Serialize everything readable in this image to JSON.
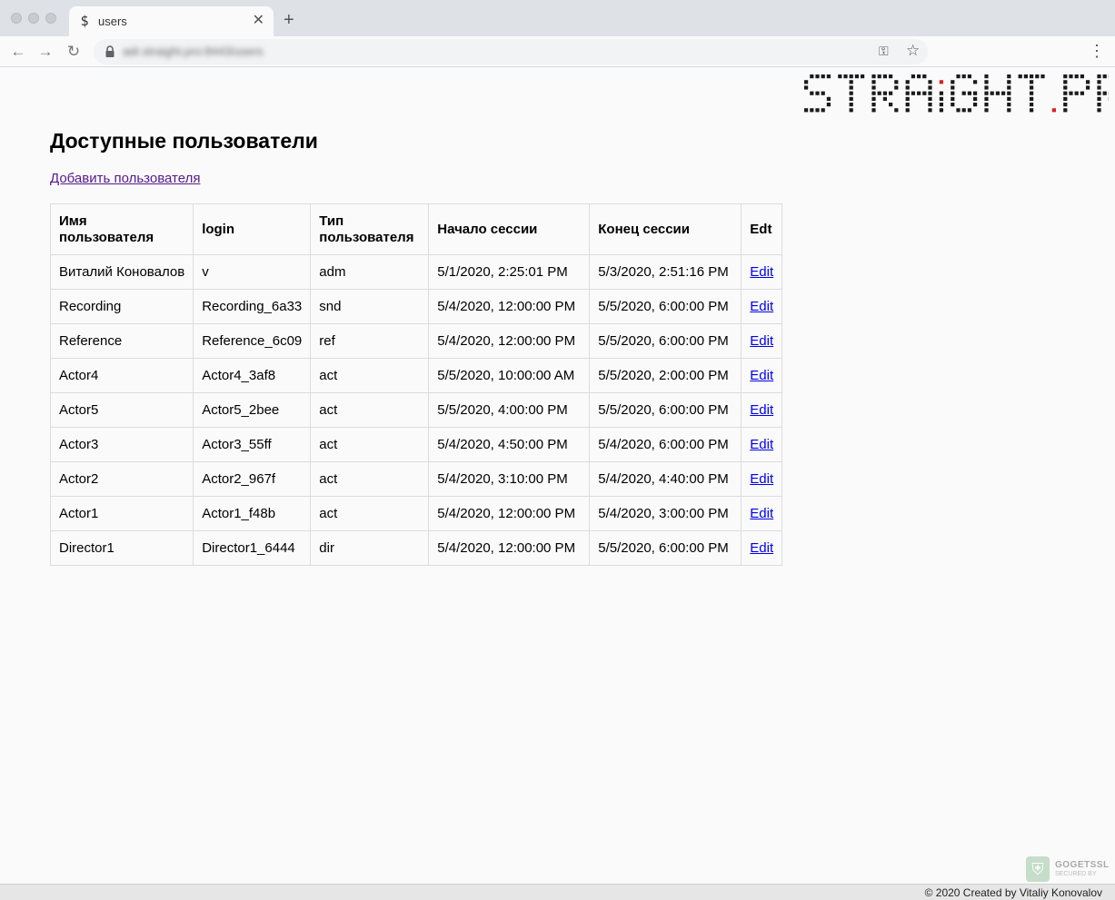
{
  "browser": {
    "tab_title": "users",
    "tab_favicon": "$",
    "url": "adr.straight.pro:8443/users",
    "icons": [
      "close-icon",
      "plus-icon",
      "back-arrow-icon",
      "forward-arrow-icon",
      "reload-icon",
      "lock-icon",
      "key-icon",
      "star-icon",
      "menu-dots-icon"
    ]
  },
  "logo": {
    "text": "STRAIGHT.PRO",
    "accent_color": "#e02020"
  },
  "page": {
    "title": "Доступные пользователи",
    "add_user_label": "Добавить пользователя"
  },
  "table": {
    "headers": {
      "name": [
        "Имя",
        "пользователя"
      ],
      "login": "login",
      "type": [
        "Тип",
        "пользователя"
      ],
      "start": "Начало сессии",
      "end": "Конец сессии",
      "edit": "Edt"
    },
    "rows": [
      {
        "name": "Виталий Коновалов",
        "login": "v",
        "type": "adm",
        "start": "5/1/2020, 2:25:01 PM",
        "end": "5/3/2020, 2:51:16 PM",
        "edit": "Edit"
      },
      {
        "name": "Recording",
        "login": "Recording_6a33",
        "type": "snd",
        "start": "5/4/2020, 12:00:00 PM",
        "end": "5/5/2020, 6:00:00 PM",
        "edit": "Edit"
      },
      {
        "name": "Reference",
        "login": "Reference_6c09",
        "type": "ref",
        "start": "5/4/2020, 12:00:00 PM",
        "end": "5/5/2020, 6:00:00 PM",
        "edit": "Edit"
      },
      {
        "name": "Actor4",
        "login": "Actor4_3af8",
        "type": "act",
        "start": "5/5/2020, 10:00:00 AM",
        "end": "5/5/2020, 2:00:00 PM",
        "edit": "Edit"
      },
      {
        "name": "Actor5",
        "login": "Actor5_2bee",
        "type": "act",
        "start": "5/5/2020, 4:00:00 PM",
        "end": "5/5/2020, 6:00:00 PM",
        "edit": "Edit"
      },
      {
        "name": "Actor3",
        "login": "Actor3_55ff",
        "type": "act",
        "start": "5/4/2020, 4:50:00 PM",
        "end": "5/4/2020, 6:00:00 PM",
        "edit": "Edit"
      },
      {
        "name": "Actor2",
        "login": "Actor2_967f",
        "type": "act",
        "start": "5/4/2020, 3:10:00 PM",
        "end": "5/4/2020, 4:40:00 PM",
        "edit": "Edit"
      },
      {
        "name": "Actor1",
        "login": "Actor1_f48b",
        "type": "act",
        "start": "5/4/2020, 12:00:00 PM",
        "end": "5/4/2020, 3:00:00 PM",
        "edit": "Edit"
      },
      {
        "name": "Director1",
        "login": "Director1_6444",
        "type": "dir",
        "start": "5/4/2020, 12:00:00 PM",
        "end": "5/5/2020, 6:00:00 PM",
        "edit": "Edit"
      }
    ]
  },
  "ssl_badge": {
    "name": "GOGETSSL",
    "sub": "SECURED BY"
  },
  "footer": {
    "text": "© 2020 Created by Vitaliy Konovalov"
  }
}
